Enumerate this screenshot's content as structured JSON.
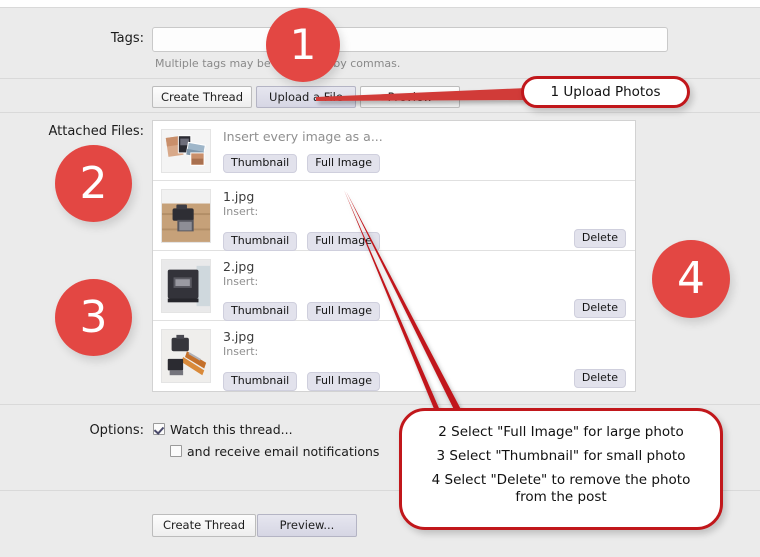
{
  "form": {
    "tags": {
      "label": "Tags:",
      "value": "",
      "placeholder": "",
      "hint": "Multiple tags may be separated by commas."
    },
    "toolbar": {
      "create_thread": "Create Thread",
      "upload_a_file": "Upload a File",
      "preview": "Preview"
    },
    "attached_files": {
      "label": "Attached Files:",
      "rows": [
        {
          "name": "Insert every image as a...",
          "is_header_row": true,
          "insert_label": "",
          "thumbnail_btn": "Thumbnail",
          "full_image_btn": "Full Image",
          "delete_btn": "",
          "thumb_kind": "photo-collage"
        },
        {
          "name": "1.jpg",
          "is_header_row": false,
          "insert_label": "Insert:",
          "thumbnail_btn": "Thumbnail",
          "full_image_btn": "Full Image",
          "delete_btn": "Delete",
          "thumb_kind": "camera-on-wood"
        },
        {
          "name": "2.jpg",
          "is_header_row": false,
          "insert_label": "Insert:",
          "thumbnail_btn": "Thumbnail",
          "full_image_btn": "Full Image",
          "delete_btn": "Delete",
          "thumb_kind": "dark-box"
        },
        {
          "name": "3.jpg",
          "is_header_row": false,
          "insert_label": "Insert:",
          "thumbnail_btn": "Thumbnail",
          "full_image_btn": "Full Image",
          "delete_btn": "Delete",
          "thumb_kind": "camera-and-cables"
        }
      ]
    },
    "options": {
      "label": "Options:",
      "watch_thread": {
        "text": "Watch this thread...",
        "checked": true
      },
      "email_notifications": {
        "text": "and receive email notifications",
        "checked": false
      }
    },
    "footer": {
      "create_thread": "Create Thread",
      "preview": "Preview..."
    }
  },
  "annotations": {
    "accent_color": "#e34743",
    "callout_border_color": "#c1171b",
    "circles": [
      {
        "number": "1"
      },
      {
        "number": "2"
      },
      {
        "number": "3"
      },
      {
        "number": "4"
      }
    ],
    "callout_upload": "1 Upload Photos",
    "callout_steps": [
      "2 Select \"Full Image\" for large photo",
      "3 Select \"Thumbnail\" for small photo",
      "4 Select \"Delete\" to remove the photo",
      "from the post"
    ]
  }
}
